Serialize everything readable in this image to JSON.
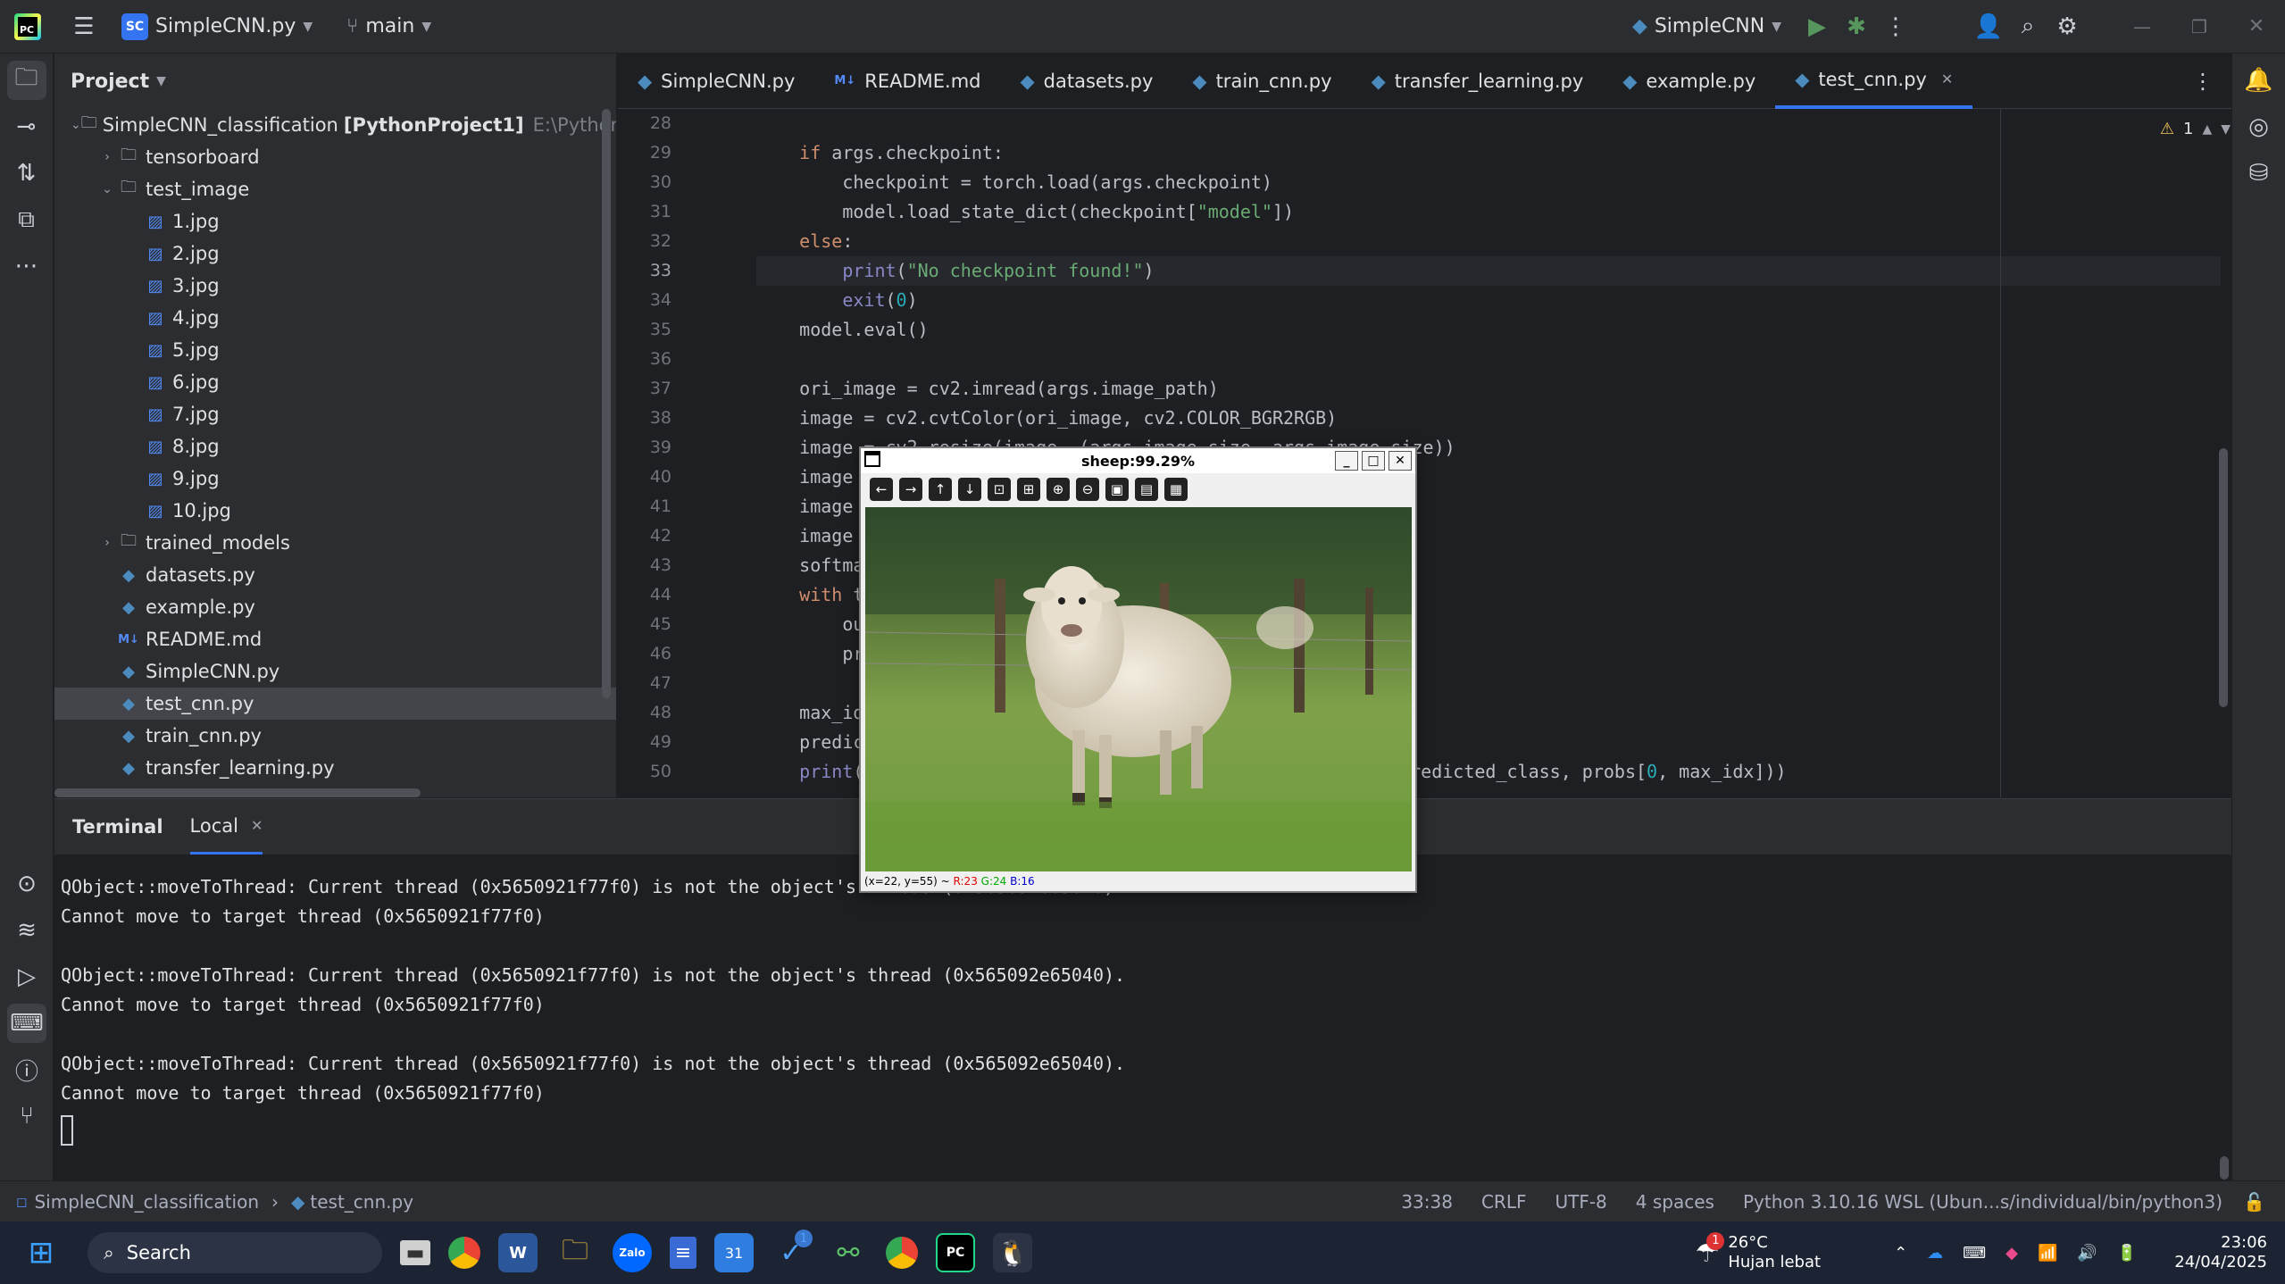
{
  "titlebar": {
    "project_badge": "SC",
    "project_name": "SimpleCNN.py",
    "branch": "main",
    "run_config": "SimpleCNN",
    "icons": [
      "pycharm-logo-icon",
      "hamburger-menu-icon",
      "branch-icon",
      "run-icon",
      "debug-icon",
      "more-icon",
      "add-user-icon",
      "search-icon",
      "gear-icon",
      "minimize-icon",
      "maximize-icon",
      "close-icon"
    ]
  },
  "project": {
    "header": "Project",
    "tree": [
      {
        "label": "SimpleCNN_classification",
        "bold_suffix": "[PythonProject1]",
        "path": "E:\\Python_Proj",
        "type": "folder",
        "depth": 0,
        "open": true
      },
      {
        "label": "tensorboard",
        "type": "folder",
        "depth": 1,
        "open": false
      },
      {
        "label": "test_image",
        "type": "folder",
        "depth": 1,
        "open": true
      },
      {
        "label": "1.jpg",
        "type": "img",
        "depth": 2
      },
      {
        "label": "2.jpg",
        "type": "img",
        "depth": 2
      },
      {
        "label": "3.jpg",
        "type": "img",
        "depth": 2
      },
      {
        "label": "4.jpg",
        "type": "img",
        "depth": 2
      },
      {
        "label": "5.jpg",
        "type": "img",
        "depth": 2
      },
      {
        "label": "6.jpg",
        "type": "img",
        "depth": 2
      },
      {
        "label": "7.jpg",
        "type": "img",
        "depth": 2
      },
      {
        "label": "8.jpg",
        "type": "img",
        "depth": 2
      },
      {
        "label": "9.jpg",
        "type": "img",
        "depth": 2
      },
      {
        "label": "10.jpg",
        "type": "img",
        "depth": 2
      },
      {
        "label": "trained_models",
        "type": "folder",
        "depth": 1,
        "open": false
      },
      {
        "label": "datasets.py",
        "type": "py",
        "depth": 1
      },
      {
        "label": "example.py",
        "type": "py",
        "depth": 1
      },
      {
        "label": "README.md",
        "type": "md",
        "depth": 1
      },
      {
        "label": "SimpleCNN.py",
        "type": "py",
        "depth": 1
      },
      {
        "label": "test_cnn.py",
        "type": "py",
        "depth": 1,
        "selected": true
      },
      {
        "label": "train_cnn.py",
        "type": "py",
        "depth": 1
      },
      {
        "label": "transfer_learning.py",
        "type": "py",
        "depth": 1
      }
    ]
  },
  "tabs": [
    {
      "label": "SimpleCNN.py",
      "type": "py"
    },
    {
      "label": "README.md",
      "type": "md"
    },
    {
      "label": "datasets.py",
      "type": "py"
    },
    {
      "label": "train_cnn.py",
      "type": "py"
    },
    {
      "label": "transfer_learning.py",
      "type": "py"
    },
    {
      "label": "example.py",
      "type": "py"
    },
    {
      "label": "test_cnn.py",
      "type": "py",
      "active": true
    }
  ],
  "editor": {
    "warnings": "1",
    "current_line": 33,
    "lines": [
      {
        "n": 28,
        "html": ""
      },
      {
        "n": 29,
        "html": "    <span class='kw'>if</span> args.checkpoint:"
      },
      {
        "n": 30,
        "html": "        checkpoint = torch.load(args.checkpoint)"
      },
      {
        "n": 31,
        "html": "        model.load_state_dict(checkpoint[<span class='str'>\"model\"</span>])"
      },
      {
        "n": 32,
        "html": "    <span class='kw'>else</span>:"
      },
      {
        "n": 33,
        "html": "        <span class='bi'>print</span>(<span class='str'>\"No checkpoint found!\"</span>)"
      },
      {
        "n": 34,
        "html": "        <span class='bi'>exit</span>(<span class='num'>0</span>)"
      },
      {
        "n": 35,
        "html": "    model.eval()"
      },
      {
        "n": 36,
        "html": ""
      },
      {
        "n": 37,
        "html": "    ori_image = cv2.imread(args.image_path)"
      },
      {
        "n": 38,
        "html": "    image = cv2.cvtColor(ori_image, cv2.COLOR_BGR2RGB)"
      },
      {
        "n": 39,
        "html": "    image = cv2.resize(image, (args.image_size, args.image_size))"
      },
      {
        "n": 40,
        "html": "    image = np"
      },
      {
        "n": 41,
        "html": "    image = im"
      },
      {
        "n": 42,
        "html": "    image = to"
      },
      {
        "n": 43,
        "html": "    softmax = "
      },
      {
        "n": 44,
        "html": "    <span class='kw'>with</span> torch"
      },
      {
        "n": 45,
        "html": "        output"
      },
      {
        "n": 46,
        "html": "        probs "
      },
      {
        "n": 47,
        "html": ""
      },
      {
        "n": 48,
        "html": "    max_idx = "
      },
      {
        "n": 49,
        "html": "    predicted_"
      },
      {
        "n": 50,
        "html": "    <span class='bi'>print</span>(<span class='str'>\"The                               </span>.format( <span style='color:#7a7e85;font-size:16px;background:#2b2d30'>*args:</span> predicted_class, probs[<span class='num'>0</span>, max_idx]))"
      }
    ]
  },
  "terminal": {
    "tab_terminal": "Terminal",
    "tab_local": "Local",
    "lines": [
      "QObject::moveToThread: Current thread (0x5650921f77f0) is not the object's thread (0x565092e65040).",
      "Cannot move to target thread (0x5650921f77f0)",
      "",
      "QObject::moveToThread: Current thread (0x5650921f77f0) is not the object's thread (0x565092e65040).",
      "Cannot move to target thread (0x5650921f77f0)",
      "",
      "QObject::moveToThread: Current thread (0x5650921f77f0) is not the object's thread (0x565092e65040).",
      "Cannot move to target thread (0x5650921f77f0)"
    ]
  },
  "statusbar": {
    "crumb_project": "SimpleCNN_classification",
    "crumb_file": "test_cnn.py",
    "position": "33:38",
    "line_sep": "CRLF",
    "encoding": "UTF-8",
    "indent": "4 spaces",
    "interpreter": "Python 3.10.16 WSL (Ubun...s/individual/bin/python3)"
  },
  "viewer": {
    "title": "sheep:99.29%",
    "status_coords": "(x=22, y=55) ~",
    "r": "R:23",
    "g": "G:24",
    "b": "B:16"
  },
  "taskbar": {
    "search": "Search",
    "weather_temp": "26°C",
    "weather_desc": "Hujan lebat",
    "weather_badge": "1",
    "time": "23:06",
    "date": "24/04/2025",
    "ie_badge": "1"
  }
}
